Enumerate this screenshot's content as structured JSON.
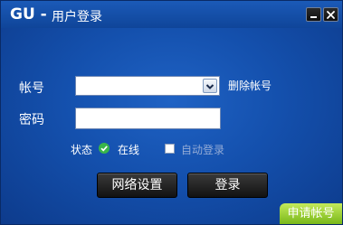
{
  "window": {
    "brand": "GU -",
    "title": "用户登录"
  },
  "form": {
    "account_label": "帐号",
    "account_value": "",
    "delete_account_link": "删除帐号",
    "password_label": "密码",
    "password_value": ""
  },
  "status": {
    "label": "状态",
    "value": "在线",
    "auto_login_label": "自动登录",
    "auto_login_checked": false
  },
  "buttons": {
    "network_settings": "网络设置",
    "login": "登录",
    "apply_account": "申请帐号"
  },
  "icons": {
    "minimize": "minimize-icon",
    "close": "close-icon",
    "dropdown": "chevron-down-icon",
    "online": "check-circle-icon"
  },
  "colors": {
    "background": "#1450ad",
    "online_green": "#39b54a",
    "apply_green": "#79b81a"
  }
}
